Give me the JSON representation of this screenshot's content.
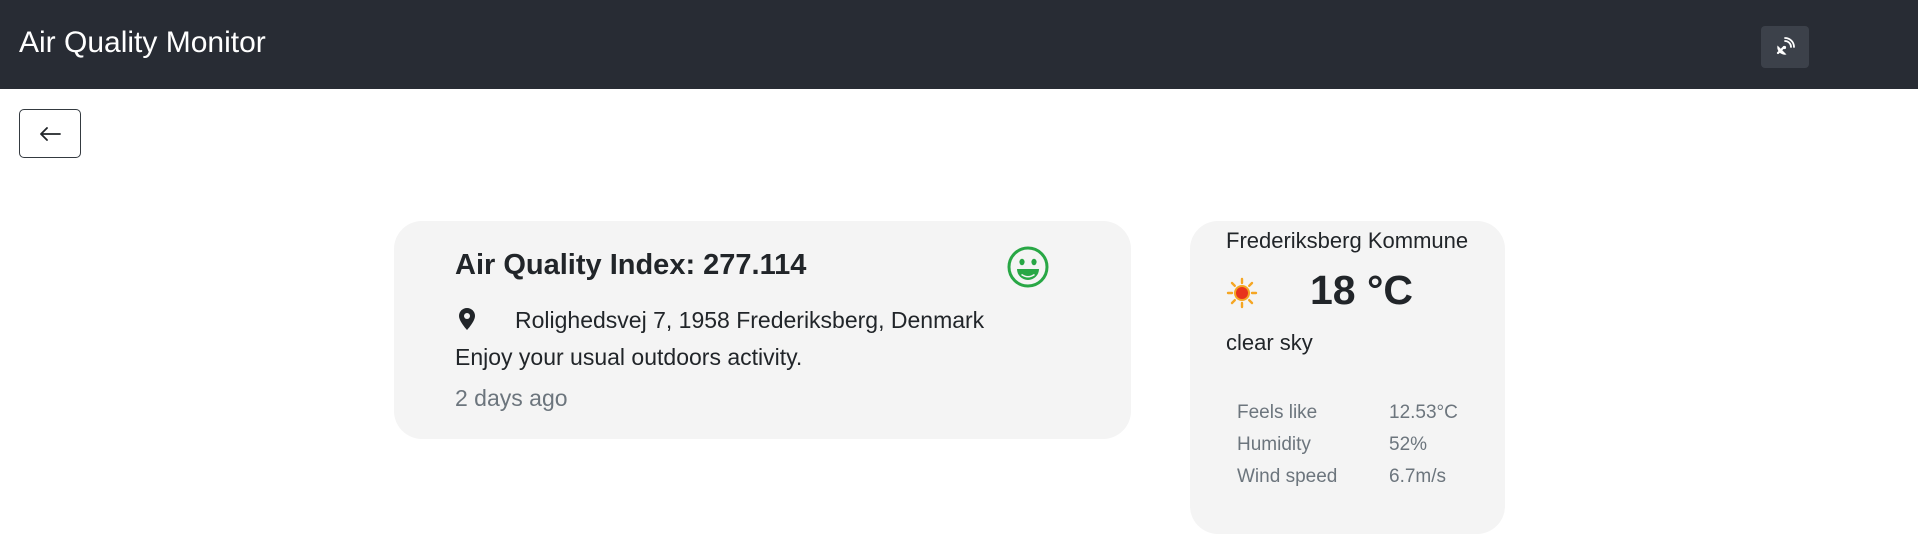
{
  "header": {
    "title": "Air Quality Monitor",
    "right_button_icon": "satellite-dish-icon"
  },
  "nav": {
    "back_label": "←"
  },
  "air_quality": {
    "title_prefix": "Air Quality Index:",
    "value": "277.114",
    "status_icon": "grinning-face-icon",
    "status_color": "#28a745",
    "address": "Rolighedsvej 7, 1958 Frederiksberg, Denmark",
    "advice": "Enjoy your usual outdoors activity.",
    "updated": "2 days ago"
  },
  "weather": {
    "city": "Frederiksberg Kommune",
    "icon": "sun-icon",
    "temperature": "18 °C",
    "description": "clear sky",
    "details": [
      {
        "label": "Feels like",
        "value": "12.53°C"
      },
      {
        "label": "Humidity",
        "value": "52%"
      },
      {
        "label": "Wind speed",
        "value": "6.7m/s"
      }
    ]
  }
}
